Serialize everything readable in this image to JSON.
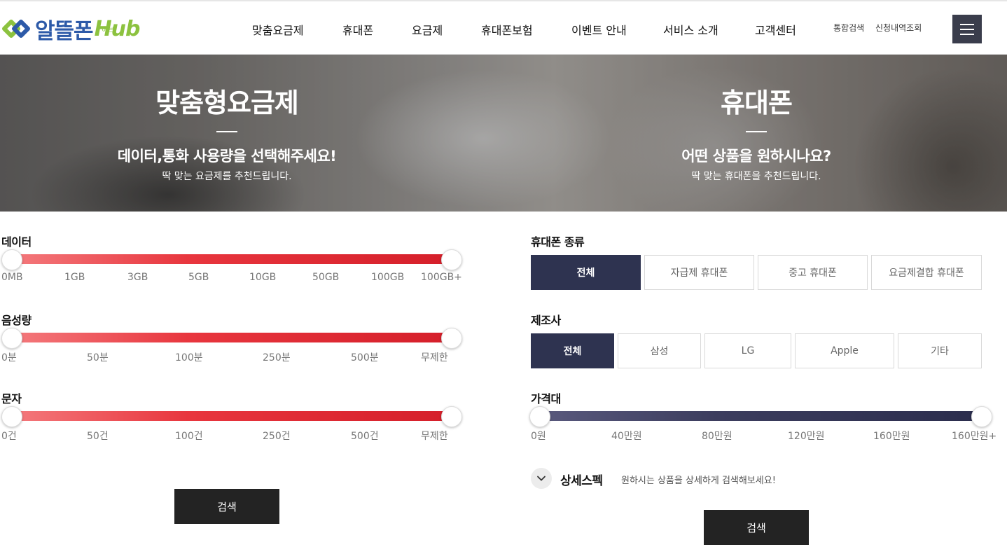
{
  "header": {
    "logo_text": "알뜰폰",
    "logo_hub": "Hub",
    "logo_sub": "허브",
    "nav": [
      "맞춤요금제",
      "휴대폰",
      "요금제",
      "휴대폰보험",
      "이벤트 안내",
      "서비스 소개",
      "고객센터"
    ],
    "util": [
      "통합검색",
      "신청내역조회"
    ]
  },
  "hero": {
    "left": {
      "title": "맞춤형요금제",
      "subtitle": "데이터,통화 사용량을 선택해주세요!",
      "desc": "딱 맞는 요금제를 추천드립니다."
    },
    "right": {
      "title": "휴대폰",
      "subtitle": "어떤 상품을 원하시나요?",
      "desc": "딱 맞는 휴대폰을 추천드립니다."
    }
  },
  "plan": {
    "data": {
      "label": "데이터",
      "ticks": [
        "0MB",
        "1GB",
        "3GB",
        "5GB",
        "10GB",
        "50GB",
        "100GB",
        "100GB+"
      ],
      "range": [
        "0MB",
        "100GB+"
      ]
    },
    "voice": {
      "label": "음성량",
      "ticks": [
        "0분",
        "50분",
        "100분",
        "250분",
        "500분",
        "무제한"
      ],
      "range": [
        "0분",
        "무제한"
      ]
    },
    "sms": {
      "label": "문자",
      "ticks": [
        "0건",
        "50건",
        "100건",
        "250건",
        "500건",
        "무제한"
      ],
      "range": [
        "0건",
        "무제한"
      ]
    },
    "search_label": "검색"
  },
  "phone": {
    "type": {
      "label": "휴대폰 종류",
      "options": [
        "전체",
        "자급제 휴대폰",
        "중고 휴대폰",
        "요금제결합 휴대폰"
      ],
      "selected": "전체"
    },
    "maker": {
      "label": "제조사",
      "options": [
        "전체",
        "삼성",
        "LG",
        "Apple",
        "기타"
      ],
      "selected": "전체"
    },
    "price": {
      "label": "가격대",
      "ticks": [
        "0원",
        "40만원",
        "80만원",
        "120만원",
        "160만원",
        "160만원+"
      ],
      "range": [
        "0원",
        "160만원+"
      ]
    },
    "spec": {
      "title": "상세스펙",
      "desc": "원하시는 상품을 상세하게 검색해보세요!"
    },
    "search_label": "검색"
  },
  "colors": {
    "navy": "#2e3350",
    "red": "#d51f2a",
    "logo_blue": "#2d5aa8",
    "logo_green": "#8cc23f"
  }
}
